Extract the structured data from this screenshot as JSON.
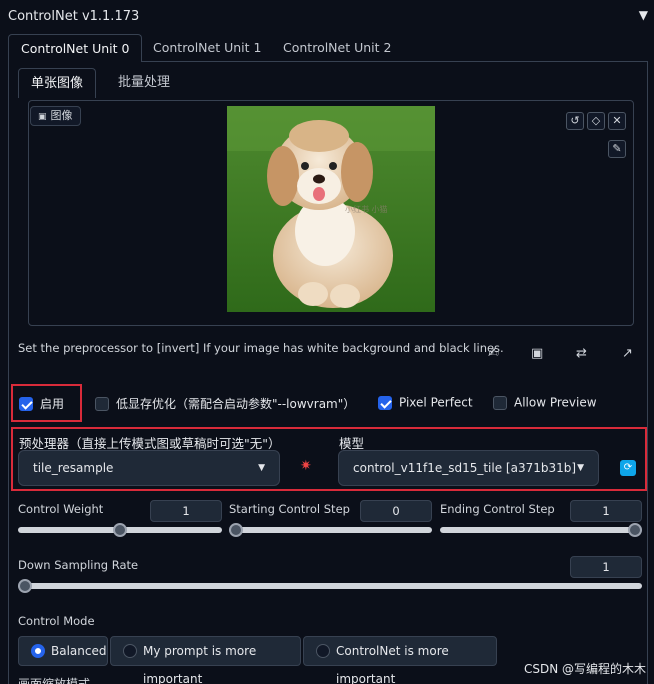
{
  "header": {
    "title": "ControlNet v1.1.173",
    "collapse_icon": "▼"
  },
  "unit_tabs": [
    "ControlNet Unit 0",
    "ControlNet Unit 1",
    "ControlNet Unit 2"
  ],
  "image_tabs": [
    "单张图像",
    "批量处理"
  ],
  "image_block": {
    "label": "图像",
    "photo_watermark": "小红书 小猫"
  },
  "hint": "Set the preprocessor to [invert] If your image has white background and black lines.",
  "options": {
    "enable": {
      "label": "启用",
      "checked": true
    },
    "lowvram": {
      "label": "低显存优化（需配合启动参数\"--lowvram\"）",
      "checked": false
    },
    "pixel_perfect": {
      "label": "Pixel Perfect",
      "checked": true
    },
    "allow_preview": {
      "label": "Allow Preview",
      "checked": false
    }
  },
  "preprocessor": {
    "label": "预处理器（直接上传模式图或草稿时可选\"无\"）",
    "value": "tile_resample"
  },
  "model": {
    "label": "模型",
    "value": "control_v11f1e_sd15_tile [a371b31b]"
  },
  "sliders": {
    "control_weight": {
      "label": "Control Weight",
      "value": "1",
      "fraction": 0.5
    },
    "starting_step": {
      "label": "Starting Control Step",
      "value": "0",
      "fraction": 0.0
    },
    "ending_step": {
      "label": "Ending Control Step",
      "value": "1",
      "fraction": 1.0
    },
    "down_sampling": {
      "label": "Down Sampling Rate",
      "value": "1",
      "fraction": 0.0
    }
  },
  "control_mode": {
    "label": "Control Mode",
    "options": [
      "Balanced",
      "My prompt is more important",
      "ControlNet is more important"
    ],
    "selected": "Balanced"
  },
  "cut_label": "画面缩放模式",
  "watermark": "CSDN @写编程的木木",
  "colors": {
    "accent": "#2563eb",
    "highlight_border": "#d92b3a",
    "background": "#0b0f19"
  }
}
